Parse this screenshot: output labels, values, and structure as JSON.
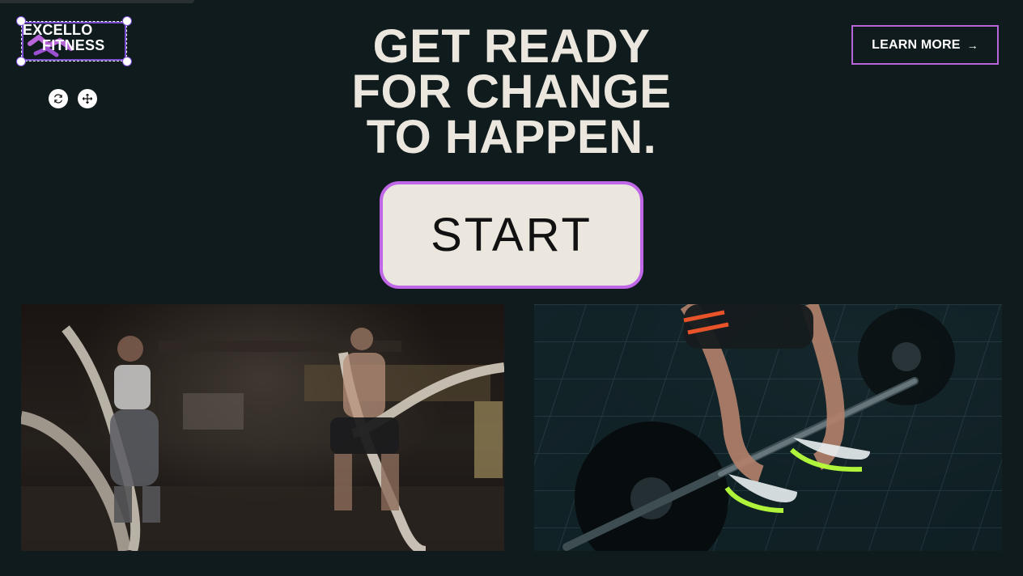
{
  "logo": {
    "line1": "EXCELLO",
    "line2": "FITNESS",
    "accent_color": "#b765d9"
  },
  "editor": {
    "tools": [
      {
        "name": "rotate-icon"
      },
      {
        "name": "move-icon"
      }
    ]
  },
  "hero": {
    "title_lines": [
      "GET READY",
      "FOR CHANGE",
      "TO HAPPEN."
    ]
  },
  "header": {
    "learn_more_label": "LEARN MORE",
    "arrow_icon": "arrow-right-icon"
  },
  "cta": {
    "start_label": "START",
    "border_color": "#bf67e6",
    "background_color": "#ebe7de"
  },
  "media": {
    "left_image": "battle-ropes-gym-photo",
    "right_image": "deadlift-barbell-photo"
  },
  "theme": {
    "page_background": "#0f1b1d",
    "text_color": "#ebe7de"
  }
}
